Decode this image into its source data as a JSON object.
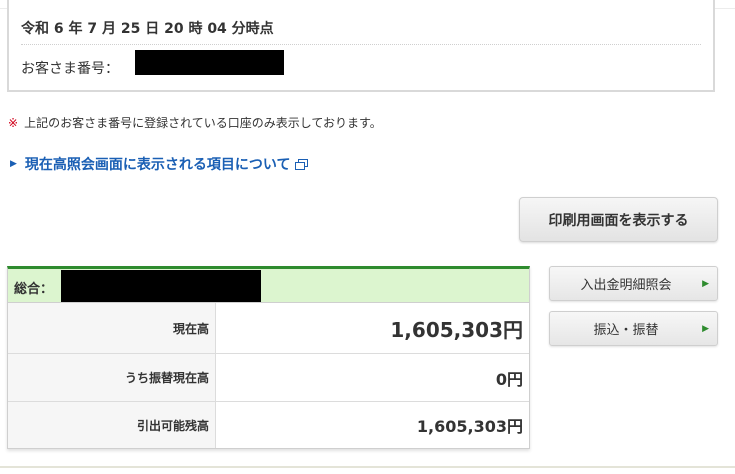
{
  "header": {
    "datetime": "令和 6 年 7 月 25 日 20 時 04 分時点",
    "customer_number_label": "お客さま番号："
  },
  "notice": {
    "mark": "※",
    "text": "上記のお客さま番号に登録されている口座のみ表示しております。"
  },
  "help_link": {
    "label": "現在高照会画面に表示される項目について"
  },
  "print_button": {
    "label": "印刷用画面を表示する"
  },
  "summary": {
    "title": "総合：",
    "rows": [
      {
        "label": "現在高",
        "value": "1,605,303円"
      },
      {
        "label": "うち振替現在高",
        "value": "0円"
      },
      {
        "label": "引出可能残高",
        "value": "1,605,303円"
      }
    ]
  },
  "side_buttons": [
    {
      "label": "入出金明細照会"
    },
    {
      "label": "振込・振替"
    }
  ],
  "colors": {
    "accent_green": "#2e8b2e",
    "header_green_bg": "#dcf5cf",
    "link_blue": "#1a5fb4",
    "notice_red": "#d0021b"
  }
}
